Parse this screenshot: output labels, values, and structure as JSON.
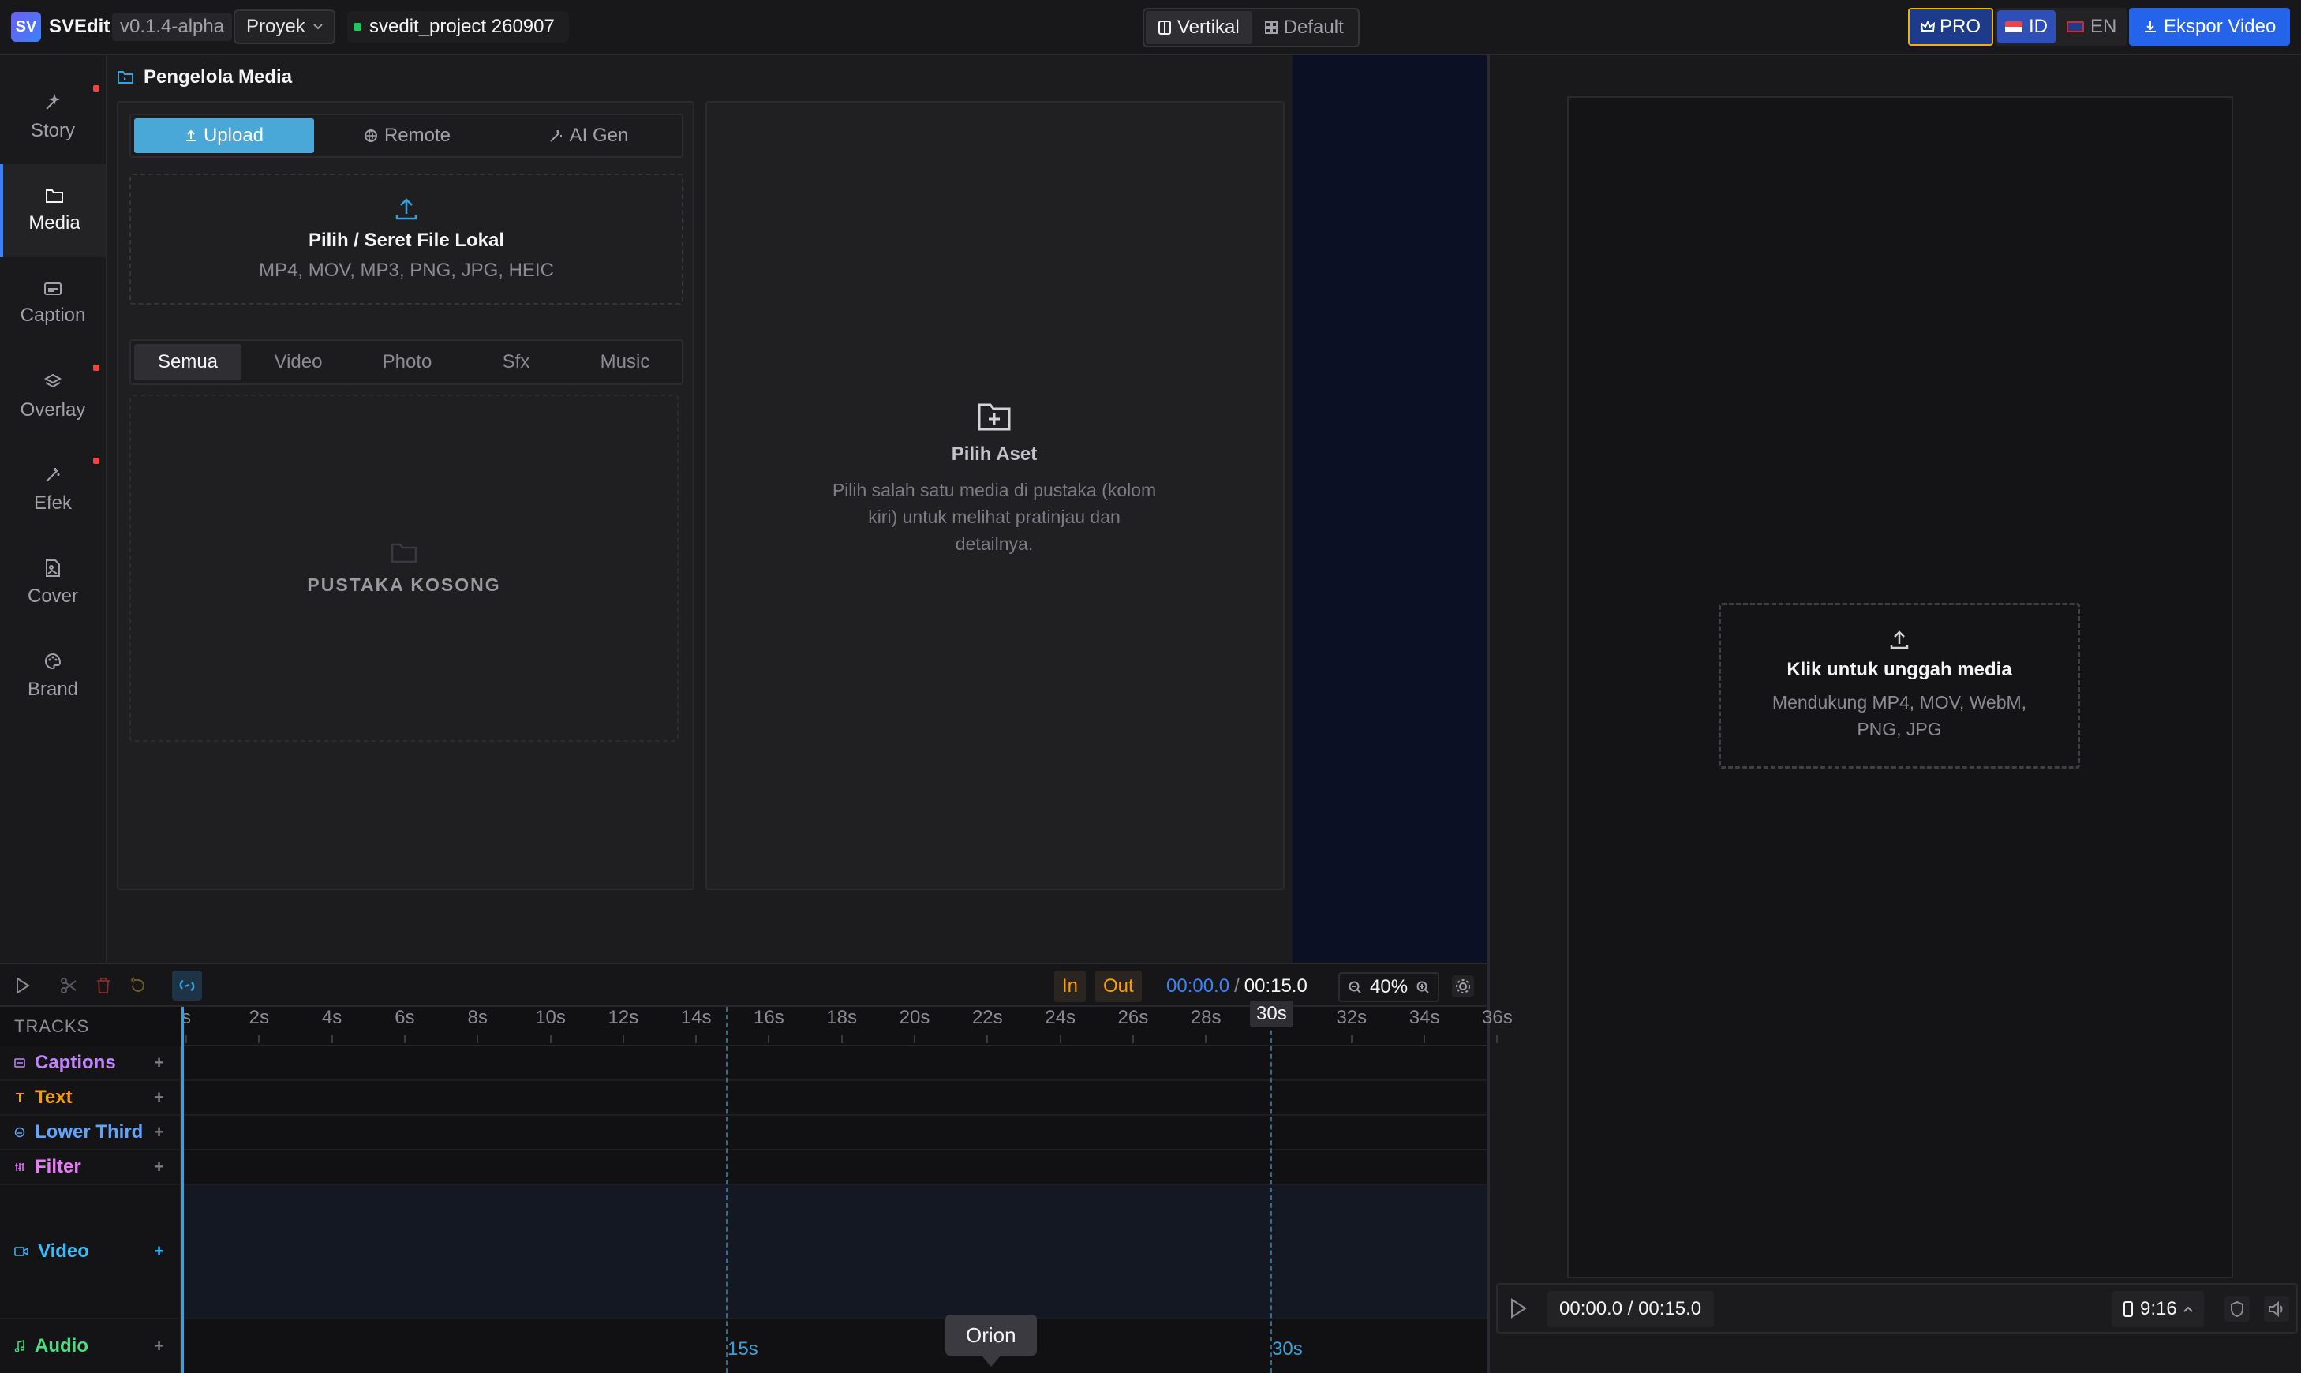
{
  "topbar": {
    "logo_text": "SV",
    "app_name": "SVEdit",
    "version": "v0.1.4-alpha",
    "project_menu": "Proyek",
    "project_name": "svedit_project 260907",
    "layout_options": [
      "Vertikal",
      "Default"
    ],
    "layout_active": "Vertikal",
    "pro_label": "PRO",
    "languages": [
      "ID",
      "EN"
    ],
    "language_active": "ID",
    "export_label": "Ekspor Video",
    "colors": {
      "accent": "#2563eb",
      "pro_border": "#eab308"
    }
  },
  "sidebar": {
    "items": [
      {
        "label": "Story",
        "icon": "magic-wand-icon",
        "badge": true
      },
      {
        "label": "Media",
        "icon": "folder-icon",
        "badge": false,
        "active": true
      },
      {
        "label": "Caption",
        "icon": "caption-icon",
        "badge": false
      },
      {
        "label": "Overlay",
        "icon": "layers-icon",
        "badge": true
      },
      {
        "label": "Efek",
        "icon": "wand-icon",
        "badge": true
      },
      {
        "label": "Cover",
        "icon": "image-file-icon",
        "badge": false
      },
      {
        "label": "Brand",
        "icon": "palette-icon",
        "badge": false
      }
    ]
  },
  "media": {
    "title": "Pengelola Media",
    "source_tabs": [
      "Upload",
      "Remote",
      "AI Gen"
    ],
    "source_active": "Upload",
    "dropzone_title": "Pilih / Seret File Lokal",
    "dropzone_formats": "MP4, MOV, MP3, PNG, JPG, HEIC",
    "filter_tabs": [
      "Semua",
      "Video",
      "Photo",
      "Sfx",
      "Music"
    ],
    "filter_active": "Semua",
    "library_empty": "PUSTAKA KOSONG",
    "asset_title": "Pilih Aset",
    "asset_desc": "Pilih salah satu media di pustaka (kolom kiri) untuk melihat pratinjau dan detailnya."
  },
  "preview": {
    "upload_title": "Klik untuk unggah media",
    "upload_formats": "Mendukung MP4, MOV, WebM, PNG, JPG",
    "time": "00:00.0 / 00:15.0",
    "aspect_ratio": "9:16"
  },
  "timeline": {
    "in_label": "In",
    "out_label": "Out",
    "current_time": "00:00.0",
    "separator": "/",
    "duration": "00:15.0",
    "zoom": "40%",
    "tracks_heading": "TRACKS",
    "ruler_ticks": [
      "s",
      "2s",
      "4s",
      "6s",
      "8s",
      "10s",
      "12s",
      "14s",
      "16s",
      "18s",
      "20s",
      "22s",
      "24s",
      "26s",
      "28s",
      "30s",
      "32s",
      "34s",
      "36s"
    ],
    "tracks": [
      {
        "name": "Captions",
        "color": "#c084fc",
        "icon": "caption-icon"
      },
      {
        "name": "Text",
        "color": "#f59e0b",
        "icon": "text-icon"
      },
      {
        "name": "Lower Third",
        "color": "#60a5fa",
        "icon": "lower-third-icon"
      },
      {
        "name": "Filter",
        "color": "#e879f9",
        "icon": "filter-icon"
      },
      {
        "name": "Video",
        "color": "#38bdf8",
        "icon": "video-icon"
      },
      {
        "name": "Audio",
        "color": "#4ade80",
        "icon": "music-icon"
      }
    ],
    "marker_15": "15s",
    "marker_30": "30s",
    "marker_30_top": "30s",
    "tooltip": "Orion"
  }
}
